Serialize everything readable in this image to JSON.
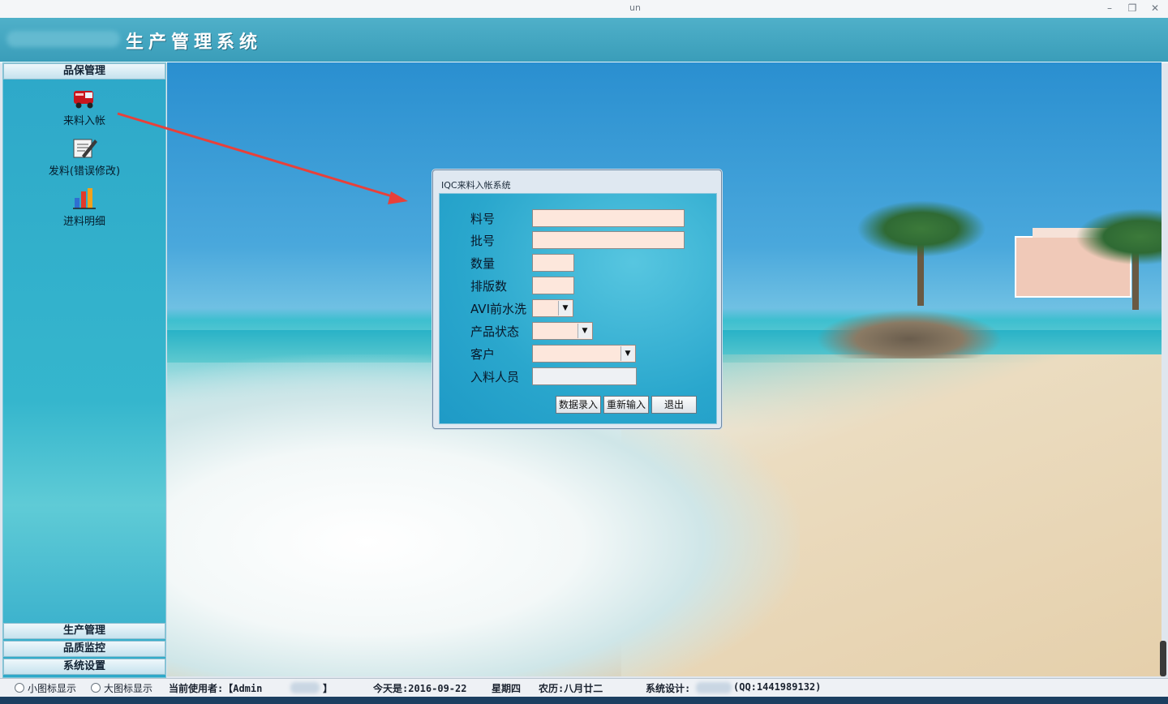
{
  "window": {
    "title_fragment": "un",
    "controls": {
      "minimize": "–",
      "restore": "❐",
      "close": "✕"
    }
  },
  "header": {
    "app_title": "生产管理系统"
  },
  "sidebar": {
    "top_section": "品保管理",
    "items": [
      {
        "label": "来料入帐",
        "icon": "truck-icon"
      },
      {
        "label": "发料(错误修改)",
        "icon": "edit-pen-icon"
      },
      {
        "label": "进料明细",
        "icon": "bar-chart-icon"
      }
    ],
    "bottom_sections": [
      "生产管理",
      "品质监控",
      "系统设置"
    ]
  },
  "dialog": {
    "title": "IQC来料入帐系统",
    "fields": {
      "part_no": {
        "label": "料号",
        "value": ""
      },
      "batch_no": {
        "label": "批号",
        "value": ""
      },
      "quantity": {
        "label": "数量",
        "value": ""
      },
      "panel_count": {
        "label": "排版数",
        "value": ""
      },
      "avi_wash": {
        "label": "AVI前水洗",
        "value": ""
      },
      "product_status": {
        "label": "产品状态",
        "value": ""
      },
      "customer": {
        "label": "客户",
        "value": ""
      },
      "receiver": {
        "label": "入料人员",
        "value": ""
      }
    },
    "buttons": {
      "submit": "数据录入",
      "reset": "重新输入",
      "exit": "退出"
    }
  },
  "statusbar": {
    "small_icon": "小图标显示",
    "large_icon": "大图标显示",
    "current_user": "当前使用者:【Admin",
    "user_suffix": "】",
    "today": "今天是:2016-09-22",
    "weekday": "星期四",
    "lunar": "农历:八月廿二",
    "designer": "系统设计:",
    "qq": "(QQ:1441989132)"
  },
  "colors": {
    "header": "#3fa3be",
    "sidebar": "#2ea8c9",
    "input_bg": "#fde7dc",
    "annotation_arrow": "#e8403a"
  }
}
